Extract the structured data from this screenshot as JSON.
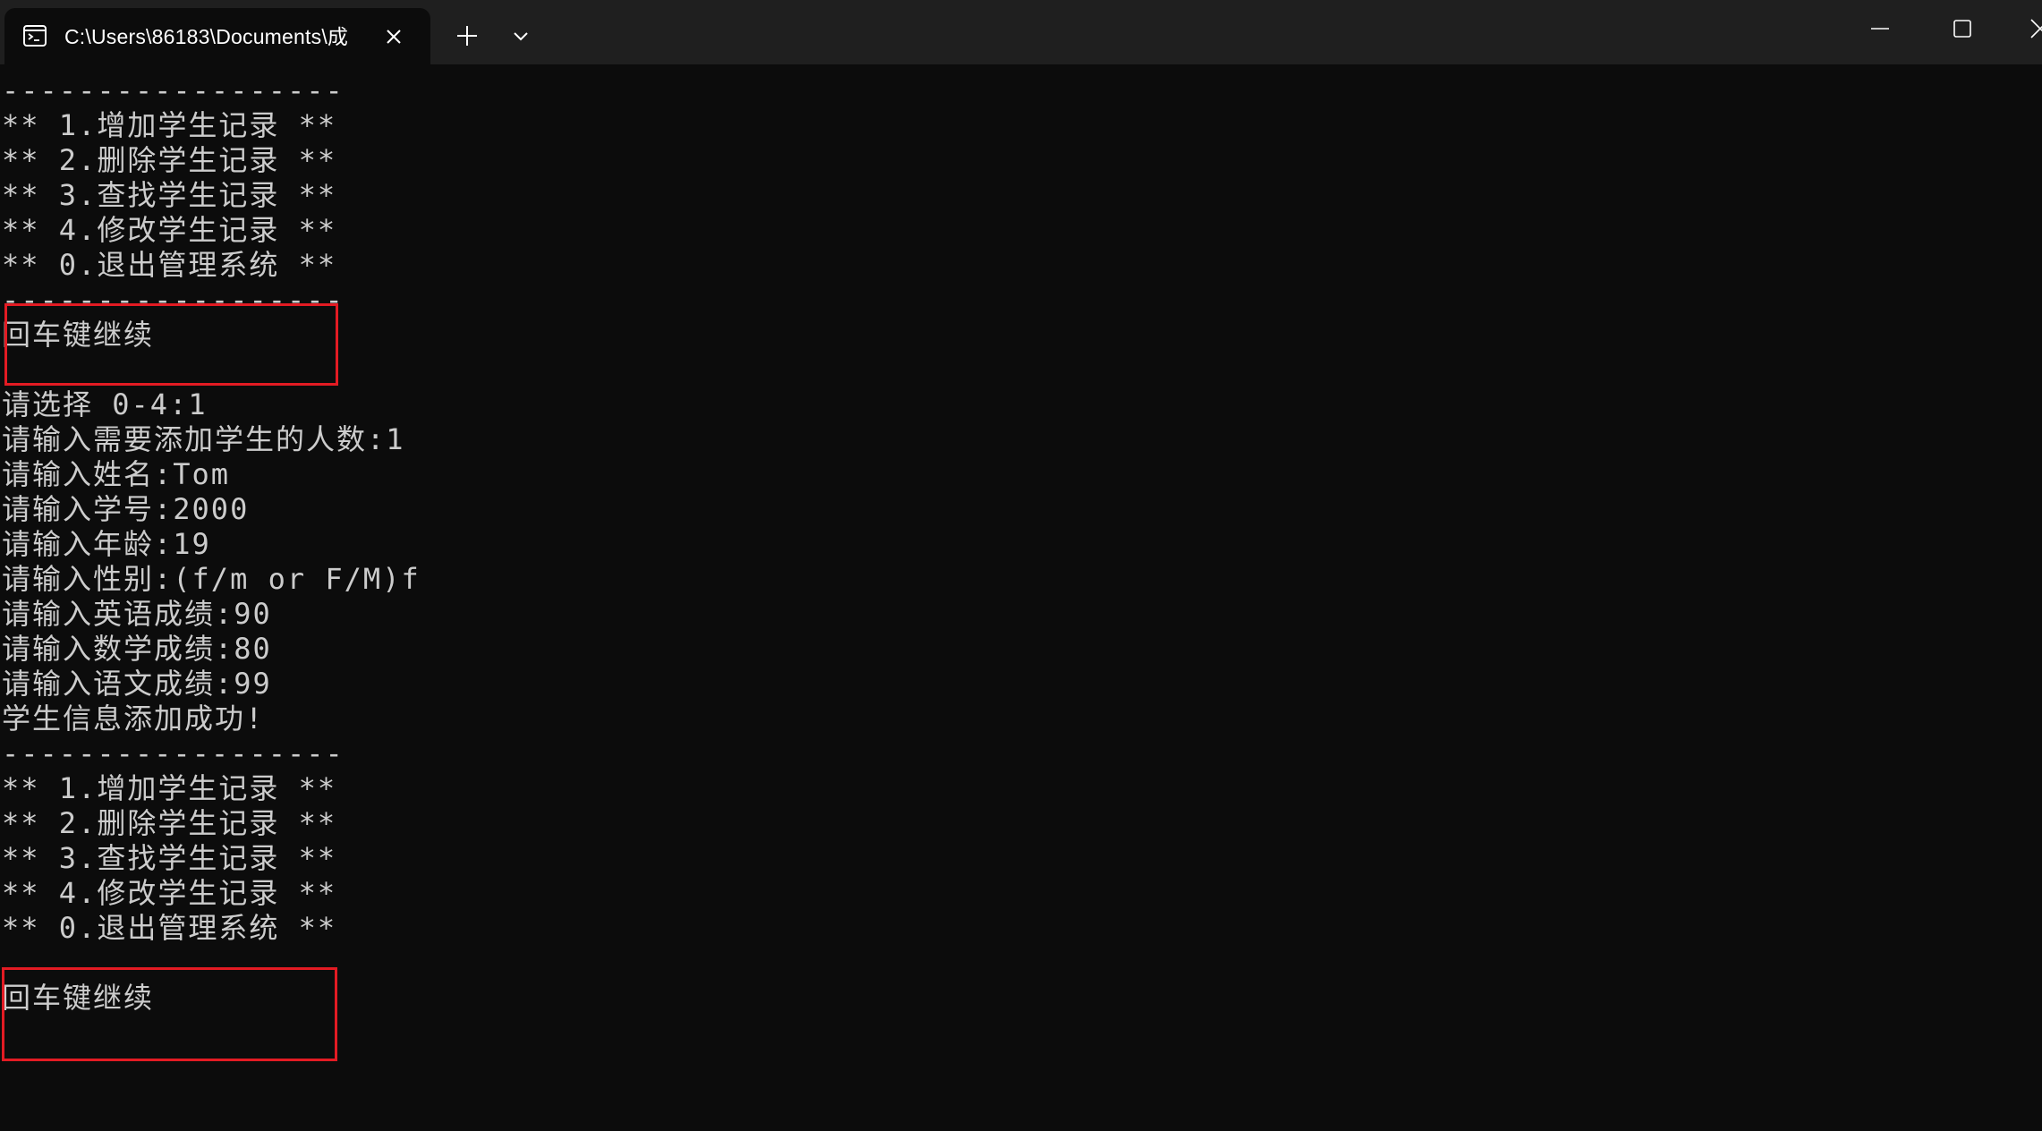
{
  "titlebar": {
    "tab_title": "C:\\Users\\86183\\Documents\\成",
    "tab_icon": "console-icon",
    "close_icon": "close-icon",
    "new_tab_icon": "plus-icon",
    "dropdown_icon": "chevron-down-icon",
    "window_controls": [
      "minimize-icon",
      "maximize-icon",
      "close-icon"
    ]
  },
  "console": {
    "lines": [
      "------------------",
      "** 1.增加学生记录 **",
      "** 2.删除学生记录 **",
      "** 3.查找学生记录 **",
      "** 4.修改学生记录 **",
      "** 0.退出管理系统 **",
      "------------------",
      "回车键继续",
      "",
      "请选择 0-4:1",
      "请输入需要添加学生的人数:1",
      "请输入姓名:Tom",
      "请输入学号:2000",
      "请输入年龄:19",
      "请输入性别:(f/m or F/M)f",
      "请输入英语成绩:90",
      "请输入数学成绩:80",
      "请输入语文成绩:99",
      "学生信息添加成功!",
      "------------------",
      "** 1.增加学生记录 **",
      "** 2.删除学生记录 **",
      "** 3.查找学生记录 **",
      "** 4.修改学生记录 **",
      "** 0.退出管理系统 **",
      "",
      "回车键继续"
    ]
  },
  "colors": {
    "background": "#0c0c0c",
    "titlebar": "#1f1f1f",
    "text": "#cccccc",
    "highlight_box": "#e31b23"
  }
}
